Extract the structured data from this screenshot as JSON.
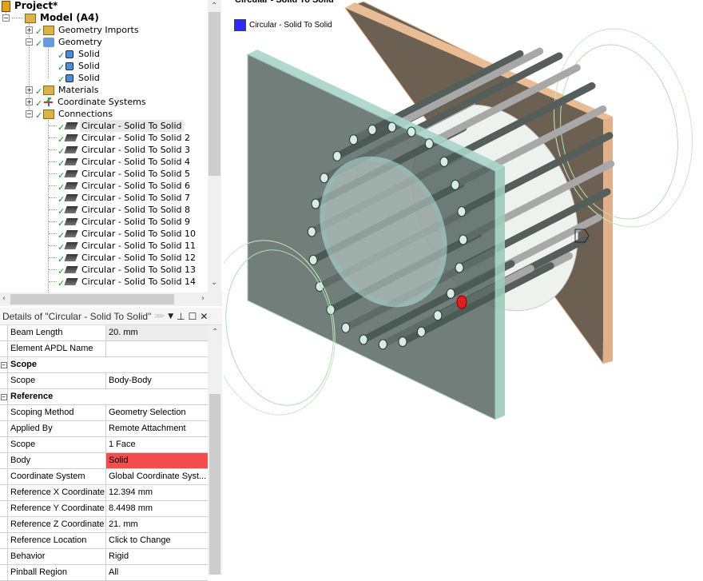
{
  "tree": {
    "project": "Project*",
    "model": "Model (A4)",
    "items": [
      {
        "label": "Geometry Imports"
      },
      {
        "label": "Geometry"
      },
      {
        "label": "Solid"
      },
      {
        "label": "Solid"
      },
      {
        "label": "Solid"
      },
      {
        "label": "Materials"
      },
      {
        "label": "Coordinate Systems"
      },
      {
        "label": "Connections"
      }
    ],
    "connections": [
      "Circular - Solid To Solid",
      "Circular - Solid To Solid 2",
      "Circular - Solid To Solid 3",
      "Circular - Solid To Solid 4",
      "Circular - Solid To Solid 5",
      "Circular - Solid To Solid 6",
      "Circular - Solid To Solid 7",
      "Circular - Solid To Solid 8",
      "Circular - Solid To Solid 9",
      "Circular - Solid To Solid 10",
      "Circular - Solid To Solid 11",
      "Circular - Solid To Solid 12",
      "Circular - Solid To Solid 13",
      "Circular - Solid To Solid 14"
    ]
  },
  "details": {
    "title": "Details of \"Circular - Solid To Solid\"",
    "rows": [
      {
        "name": "Beam Length",
        "value": "20. mm",
        "style": "shade"
      },
      {
        "name": "Element APDL Name",
        "value": ""
      },
      {
        "section": "Scope"
      },
      {
        "name": "Scope",
        "value": "Body-Body"
      },
      {
        "section": "Reference"
      },
      {
        "name": "Scoping Method",
        "value": "Geometry Selection"
      },
      {
        "name": "Applied By",
        "value": "Remote Attachment"
      },
      {
        "name": "Scope",
        "value": "1 Face"
      },
      {
        "name": "Body",
        "value": "Solid",
        "style": "red"
      },
      {
        "name": "Coordinate System",
        "value": "Global Coordinate Syst..."
      },
      {
        "name": "Reference X Coordinate",
        "value": "12.394 mm"
      },
      {
        "name": "Reference Y Coordinate",
        "value": "8.4498 mm"
      },
      {
        "name": "Reference Z Coordinate",
        "value": "21. mm"
      },
      {
        "name": "Reference Location",
        "value": "Click to Change"
      },
      {
        "name": "Behavior",
        "value": "Rigid"
      },
      {
        "name": "Pinball Region",
        "value": "All"
      }
    ]
  },
  "viewport": {
    "title": "Circular - Solid To Solid",
    "legend": {
      "label": "Circular - Solid To Solid",
      "color": "#2b2bff"
    }
  }
}
